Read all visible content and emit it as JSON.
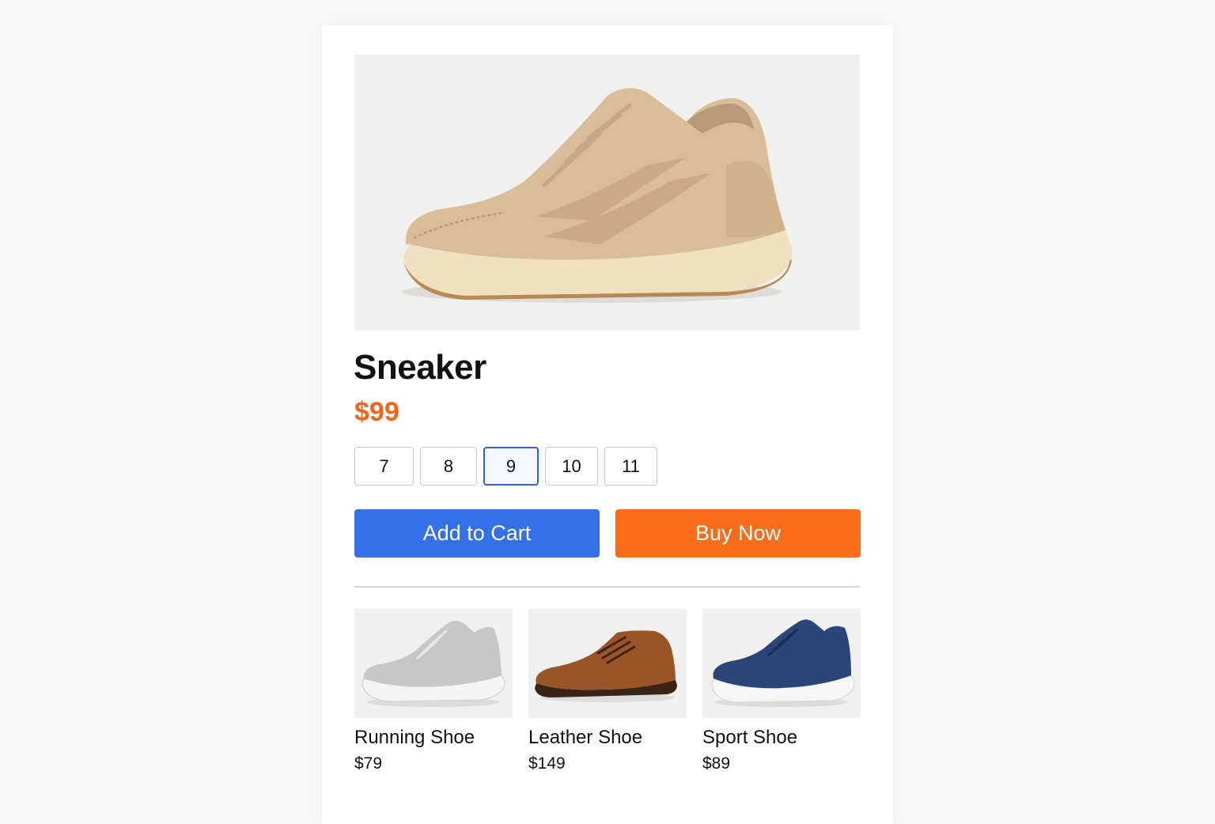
{
  "product": {
    "image_icon": "beige-sneaker-image",
    "title": "Sneaker",
    "price": "$99",
    "price_color": "#f26419"
  },
  "sizes": {
    "options": [
      "7",
      "8",
      "9",
      "10",
      "11"
    ],
    "selected": "9"
  },
  "actions": {
    "add_to_cart_label": "Add to Cart",
    "add_to_cart_color": "#3470e9",
    "buy_now_label": "Buy Now",
    "buy_now_color": "#f76d1a"
  },
  "related": [
    {
      "name": "Running Shoe",
      "price": "$79",
      "image_icon": "gray-running-shoe-image"
    },
    {
      "name": "Leather Shoe",
      "price": "$149",
      "image_icon": "brown-leather-shoe-image"
    },
    {
      "name": "Sport Shoe",
      "price": "$89",
      "image_icon": "navy-sport-shoe-image"
    }
  ]
}
